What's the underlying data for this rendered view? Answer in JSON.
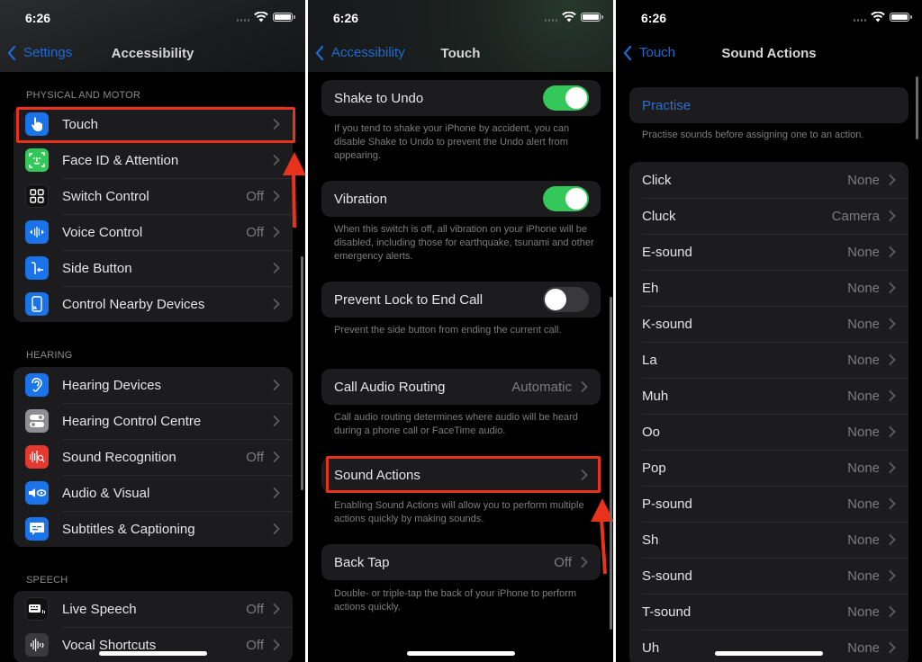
{
  "status_bar": {
    "time": "6:26"
  },
  "panel1": {
    "back_label": "Settings",
    "title": "Accessibility",
    "sections": [
      {
        "header": "PHYSICAL AND MOTOR",
        "items": [
          {
            "label": "Touch",
            "value": "",
            "icon": "hand-pointer-icon",
            "color": "#1a73e8"
          },
          {
            "label": "Face ID & Attention",
            "value": "",
            "icon": "face-id-icon",
            "color": "#34c759"
          },
          {
            "label": "Switch Control",
            "value": "Off",
            "icon": "switch-grid-icon",
            "color": "#111111"
          },
          {
            "label": "Voice Control",
            "value": "Off",
            "icon": "voice-waveform-icon",
            "color": "#1a73e8"
          },
          {
            "label": "Side Button",
            "value": "",
            "icon": "side-button-icon",
            "color": "#1a73e8"
          },
          {
            "label": "Control Nearby Devices",
            "value": "",
            "icon": "nearby-devices-icon",
            "color": "#1a73e8"
          }
        ]
      },
      {
        "header": "HEARING",
        "items": [
          {
            "label": "Hearing Devices",
            "value": "",
            "icon": "ear-icon",
            "color": "#1a73e8"
          },
          {
            "label": "Hearing Control Centre",
            "value": "",
            "icon": "toggles-icon",
            "color": "#8e8e93"
          },
          {
            "label": "Sound Recognition",
            "value": "Off",
            "icon": "sound-recognition-icon",
            "color": "#e5392f"
          },
          {
            "label": "Audio & Visual",
            "value": "",
            "icon": "audio-visual-icon",
            "color": "#1a73e8"
          },
          {
            "label": "Subtitles & Captioning",
            "value": "",
            "icon": "captions-icon",
            "color": "#1a73e8"
          }
        ]
      },
      {
        "header": "SPEECH",
        "items": [
          {
            "label": "Live Speech",
            "value": "Off",
            "icon": "keyboard-speech-icon",
            "color": "#111111"
          },
          {
            "label": "Vocal Shortcuts",
            "value": "Off",
            "icon": "vocal-waveform-icon",
            "color": "#3a3a3c"
          }
        ]
      }
    ]
  },
  "panel2": {
    "back_label": "Accessibility",
    "title": "Touch",
    "settings": [
      {
        "label": "Shake to Undo",
        "type": "toggle",
        "on": true,
        "footnote": "If you tend to shake your iPhone by accident, you can disable Shake to Undo to prevent the Undo alert from appearing."
      },
      {
        "label": "Vibration",
        "type": "toggle",
        "on": true,
        "footnote": "When this switch is off, all vibration on your iPhone will be disabled, including those for earthquake, tsunami and other emergency alerts."
      },
      {
        "label": "Prevent Lock to End Call",
        "type": "toggle",
        "on": false,
        "footnote": "Prevent the side button from ending the current call."
      },
      {
        "label": "Call Audio Routing",
        "type": "link",
        "value": "Automatic",
        "footnote": "Call audio routing determines where audio will be heard during a phone call or FaceTime audio."
      },
      {
        "label": "Sound Actions",
        "type": "link",
        "value": "",
        "footnote": "Enabling Sound Actions will allow you to perform multiple actions quickly by making sounds."
      },
      {
        "label": "Back Tap",
        "type": "link",
        "value": "Off",
        "footnote": "Double- or triple-tap the back of your iPhone to perform actions quickly."
      }
    ]
  },
  "panel3": {
    "back_label": "Touch",
    "title": "Sound Actions",
    "practise_label": "Practise",
    "practise_footnote": "Practise sounds before assigning one to an action.",
    "sounds": [
      {
        "label": "Click",
        "value": "None"
      },
      {
        "label": "Cluck",
        "value": "Camera"
      },
      {
        "label": "E-sound",
        "value": "None"
      },
      {
        "label": "Eh",
        "value": "None"
      },
      {
        "label": "K-sound",
        "value": "None"
      },
      {
        "label": "La",
        "value": "None"
      },
      {
        "label": "Muh",
        "value": "None"
      },
      {
        "label": "Oo",
        "value": "None"
      },
      {
        "label": "Pop",
        "value": "None"
      },
      {
        "label": "P-sound",
        "value": "None"
      },
      {
        "label": "Sh",
        "value": "None"
      },
      {
        "label": "S-sound",
        "value": "None"
      },
      {
        "label": "T-sound",
        "value": "None"
      },
      {
        "label": "Uh",
        "value": "None"
      }
    ]
  },
  "annotations": {
    "highlight_color": "#e8321c"
  }
}
